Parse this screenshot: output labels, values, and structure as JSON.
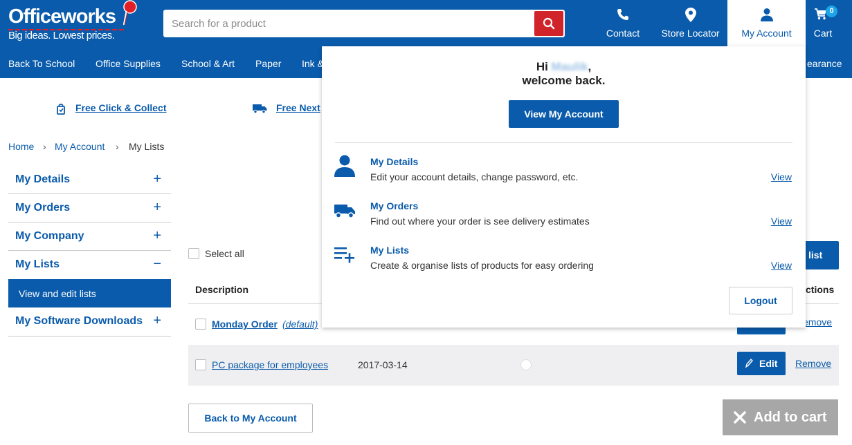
{
  "brand": {
    "name": "Officeworks",
    "tagline": "Big ideas. Lowest prices."
  },
  "search": {
    "placeholder": "Search for a product"
  },
  "header_nav": {
    "contact": "Contact",
    "store_locator": "Store Locator",
    "my_account": "My Account",
    "cart": "Cart",
    "cart_count": "0"
  },
  "categories": [
    "Back To School",
    "Office Supplies",
    "School & Art",
    "Paper",
    "Ink &",
    "earance"
  ],
  "promos": {
    "click_collect": "Free Click & Collect",
    "delivery": "Free Next"
  },
  "breadcrumb": [
    "Home",
    "My Account",
    "My Lists"
  ],
  "sidebar": {
    "items": [
      {
        "label": "My Details",
        "toggle": "+"
      },
      {
        "label": "My Orders",
        "toggle": "+"
      },
      {
        "label": "My Company",
        "toggle": "+"
      },
      {
        "label": "My Lists",
        "toggle": "−"
      },
      {
        "label": "My Software Downloads",
        "toggle": "+"
      }
    ],
    "sub_item": "View and edit lists"
  },
  "lists": {
    "select_all": "Select all",
    "new_list_partial": "list",
    "columns": {
      "description": "Description",
      "actions_partial": "ctions"
    },
    "rows": [
      {
        "name": "Monday Order",
        "tag": "(default)",
        "date": "",
        "remove": "emove"
      },
      {
        "name": "PC package for employees",
        "date": "2017-03-14",
        "edit": "Edit",
        "remove": "Remove"
      }
    ],
    "back_button": "Back to My Account",
    "add_to_cart": "Add to cart"
  },
  "account_dropdown": {
    "greeting_prefix": "Hi",
    "user_name": "Maulik",
    "greeting_suffix": ",",
    "welcome": "welcome back.",
    "view_account": "View My Account",
    "sections": [
      {
        "title": "My Details",
        "desc": "Edit your account details, change password, etc.",
        "link": "View",
        "icon": "person-icon"
      },
      {
        "title": "My Orders",
        "desc": "Find out where your order is see delivery estimates",
        "link": "View",
        "icon": "truck-icon"
      },
      {
        "title": "My Lists",
        "desc": "Create & organise lists of products for easy ordering",
        "link": "View",
        "icon": "list-add-icon"
      }
    ],
    "logout": "Logout"
  },
  "colors": {
    "brand_blue": "#0a5bab",
    "search_red": "#d0232a",
    "badge_blue": "#1ea5e8",
    "disabled_grey": "#a7a7a7"
  }
}
